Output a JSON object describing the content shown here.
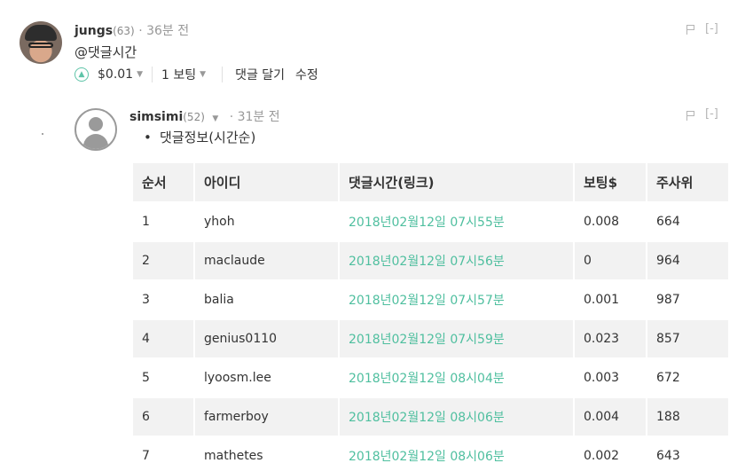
{
  "comment1": {
    "author": "jungs",
    "reputation": "(63)",
    "time": "· 36분 전",
    "body": "@댓글시간",
    "payout": "$0.01",
    "votes": "1 보팅",
    "reply_label": "댓글 달기",
    "edit_label": "수정",
    "collapse_label": "[-]"
  },
  "comment2": {
    "author": "simsimi",
    "reputation": "(52)",
    "time": "· 31분 전",
    "bullet": "댓글정보(시간순)",
    "collapse_label": "[-]"
  },
  "table": {
    "headers": [
      "순서",
      "아이디",
      "댓글시간(링크)",
      "보팅$",
      "주사위"
    ],
    "rows": [
      [
        "1",
        "yhoh",
        "2018년02월12일 07시55분",
        "0.008",
        "664"
      ],
      [
        "2",
        "maclaude",
        "2018년02월12일 07시56분",
        "0",
        "964"
      ],
      [
        "3",
        "balia",
        "2018년02월12일 07시57분",
        "0.001",
        "987"
      ],
      [
        "4",
        "genius0110",
        "2018년02월12일 07시59분",
        "0.023",
        "857"
      ],
      [
        "5",
        "lyoosm.lee",
        "2018년02월12일 08시04분",
        "0.003",
        "672"
      ],
      [
        "6",
        "farmerboy",
        "2018년02월12일 08시06분",
        "0.004",
        "188"
      ],
      [
        "7",
        "mathetes",
        "2018년02월12일 08시06분",
        "0.002",
        "643"
      ]
    ]
  },
  "icons": {
    "upvote": "upvote-circle-icon",
    "flag": "flag-icon",
    "dropdown": "chevron-down-icon",
    "avatar_default": "default-user-icon"
  },
  "colors": {
    "accent": "#4fbf9f",
    "muted": "#999999",
    "table_stripe": "#f2f2f2"
  }
}
